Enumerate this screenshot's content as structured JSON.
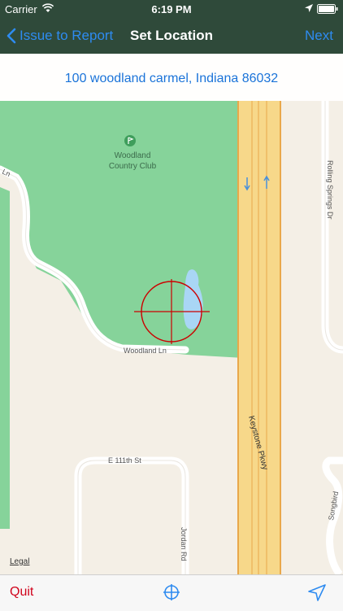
{
  "status_bar": {
    "carrier": "Carrier",
    "time": "6:19 PM",
    "icons": [
      "wifi-icon",
      "location-arrow-icon",
      "battery-icon"
    ]
  },
  "nav": {
    "back_label": "Issue to Report",
    "title": "Set Location",
    "next_label": "Next"
  },
  "address": "100 woodland carmel, Indiana 86032",
  "map": {
    "place_label_line1": "Woodland",
    "place_label_line2": "Country Club",
    "roads": {
      "woodland_ln": "Woodland Ln",
      "ln_partial": "Ln",
      "keystone": "Keystone Pkwy",
      "rolling_springs": "Rolling Springs Dr",
      "e111th": "E 111th St",
      "jordan": "Jordan Rd",
      "songbird": "Songbird"
    },
    "legal": "Legal",
    "colors": {
      "park": "#86d39a",
      "land": "#f4efe6",
      "highway": "#f7d88a",
      "highway_edge": "#e9a84a",
      "water": "#a9d6f5",
      "target": "#cc0000"
    }
  },
  "toolbar": {
    "quit_label": "Quit",
    "icons": [
      "crosshair-icon",
      "location-arrow-icon"
    ]
  }
}
